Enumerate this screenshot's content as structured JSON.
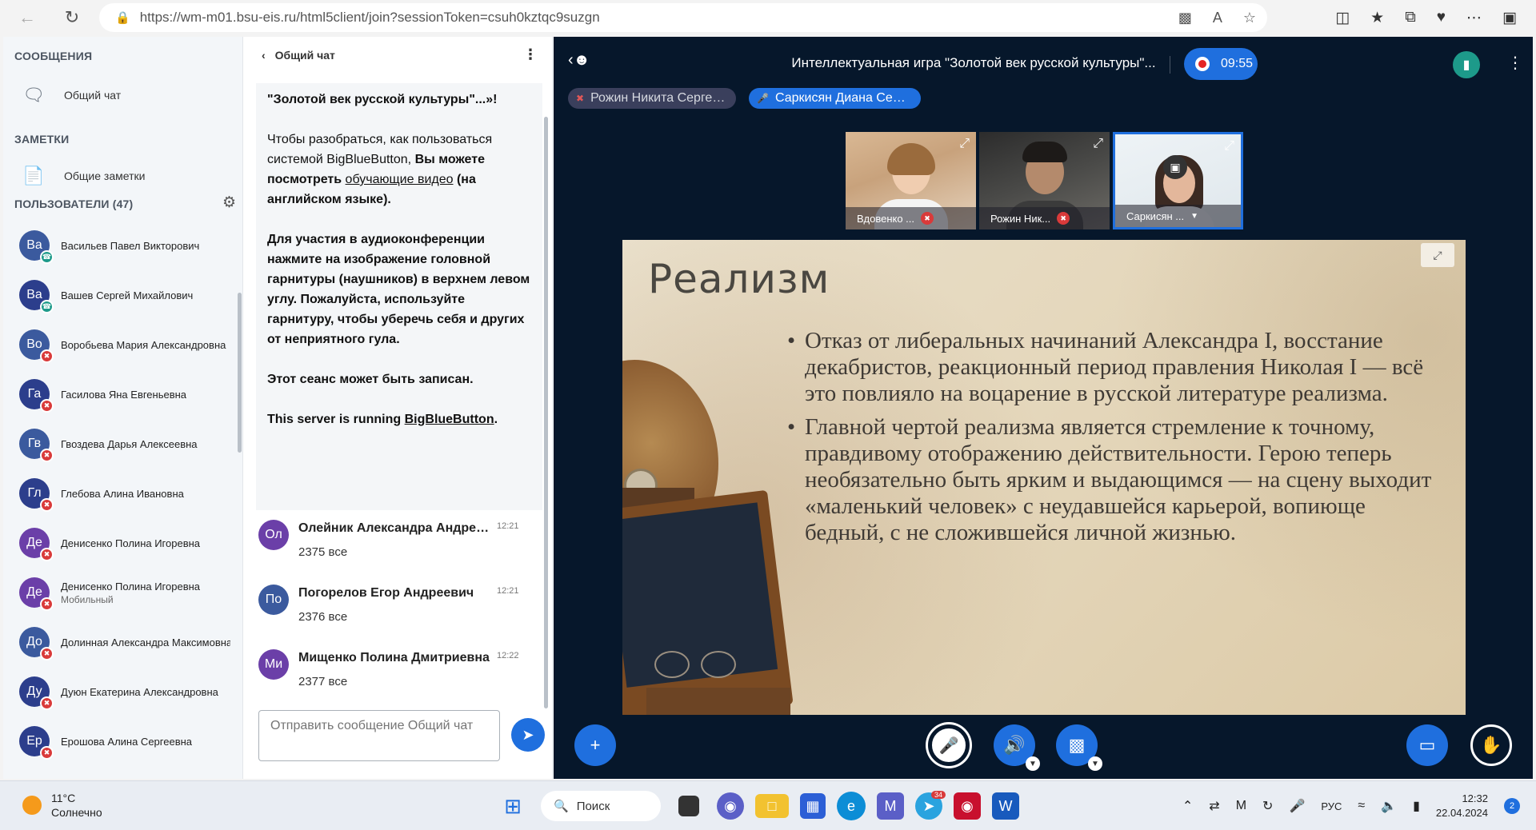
{
  "browser": {
    "url": "https://wm-m01.bsu-eis.ru/html5client/join?sessionToken=csuh0kztqc9suzgn"
  },
  "sidebar": {
    "messages_title": "СООБЩЕНИЯ",
    "public_chat_label": "Общий чат",
    "notes_title": "ЗАМЕТКИ",
    "shared_notes_label": "Общие заметки",
    "users_title": "ПОЛЬЗОВАТЕЛИ (47)",
    "users": [
      {
        "initials": "Ва",
        "name": "Васильев Павел Викторович",
        "sub": "",
        "status": "listen"
      },
      {
        "initials": "Ва",
        "name": "Вашев Сергей Михайлович",
        "sub": "",
        "status": "listen"
      },
      {
        "initials": "Во",
        "name": "Воробьева Мария Александровна",
        "sub": "",
        "status": "muted"
      },
      {
        "initials": "Га",
        "name": "Гасилова Яна Евгеньевна",
        "sub": "",
        "status": "muted"
      },
      {
        "initials": "Гв",
        "name": "Гвоздева Дарья Алексеевна",
        "sub": "",
        "status": "muted"
      },
      {
        "initials": "Гл",
        "name": "Глебова Алина Ивановна",
        "sub": "",
        "status": "muted"
      },
      {
        "initials": "Де",
        "name": "Денисенко Полина Игоревна",
        "sub": "",
        "status": "muted"
      },
      {
        "initials": "Де",
        "name": "Денисенко Полина Игоревна",
        "sub": "Мобильный",
        "status": "muted"
      },
      {
        "initials": "До",
        "name": "Долинная Александра Максимовна",
        "sub": "",
        "status": "muted"
      },
      {
        "initials": "Ду",
        "name": "Дуюн Екатерина Александровна",
        "sub": "",
        "status": "muted"
      },
      {
        "initials": "Ер",
        "name": "Ерошова Алина Сергеевна",
        "sub": "",
        "status": "muted"
      }
    ]
  },
  "chat": {
    "title": "Общий чат",
    "welcome": {
      "p1": "\"Золотой век русской культуры\"...»!",
      "p2a": "Чтобы разобраться, как пользоваться системой BigBlueButton, ",
      "p2b": "Вы можете посмотреть ",
      "p2link": "обучающие видео",
      "p2c": " (на английском языке).",
      "p3a": "Для участия в аудиоконференции нажмите на изображение головной гарнитуры (наушников) в верхнем левом углу. ",
      "p3b": "Пожалуйста, используйте гарнитуру, чтобы уберечь себя и других от неприятного гула.",
      "p4": "Этот сеанс может быть записан.",
      "p5a": "This server is running ",
      "p5link": "BigBlueButton",
      "p5b": "."
    },
    "messages": [
      {
        "initials": "Ол",
        "author": "Олейник Александра Андреевна",
        "time": "12:21",
        "text": "2375 все"
      },
      {
        "initials": "По",
        "author": "Погорелов Егор Андреевич",
        "time": "12:21",
        "text": "2376 все"
      },
      {
        "initials": "Ми",
        "author": "Мищенко Полина Дмитриевна",
        "time": "12:22",
        "text": "2377 все"
      }
    ],
    "input_placeholder": "Отправить сообщение Общий чат"
  },
  "main": {
    "session_title": "Интеллектуальная игра \"Золотой век русской культуры\"...",
    "recording_time": "09:55",
    "talkers": [
      {
        "name": "Рожин Никита Сергеевич",
        "state": "muted"
      },
      {
        "name": "Саркисян Диана Сергеевна",
        "state": "talking"
      }
    ],
    "videos": [
      {
        "name": "Вдовенко ..."
      },
      {
        "name": "Рожин Ник..."
      },
      {
        "name": "Саркисян ..."
      }
    ],
    "slide": {
      "title": "Реализм",
      "bullets": [
        "Отказ от либеральных начинаний Александра I, восстание декабристов, реакционный период правления Николая I — всё это повлияло на воцарение в русской литературе реализма.",
        "Главной чертой реализма является стремление к точному, правдивому отображению действительности. Герою теперь необязательно быть ярким и выдающимся — на сцену выходит «маленький человек» с неудавшейся карьерой, вопиюще бедный, с не сложившейся личной жизнью."
      ]
    }
  },
  "taskbar": {
    "temperature": "11°C",
    "weather": "Солнечно",
    "search_label": "Поиск",
    "telegram_badge": "34",
    "language": "РУС",
    "time": "12:32",
    "date": "22.04.2024",
    "notifications": "2"
  }
}
